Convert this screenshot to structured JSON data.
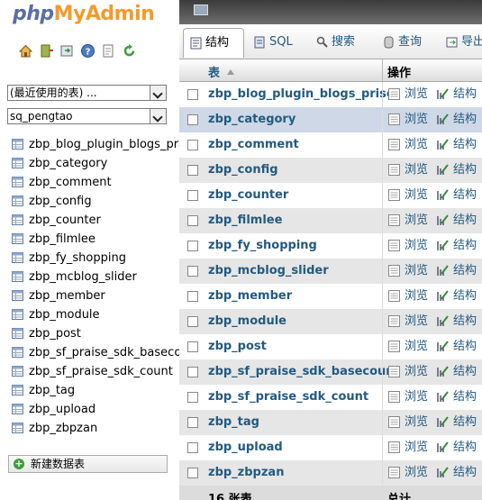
{
  "app": {
    "logo_php": "php",
    "logo_myadmin": "MyAdmin"
  },
  "nav_icons": [
    "home-icon",
    "exit-icon",
    "query-window-icon",
    "help-icon",
    "docs-icon",
    "reload-icon"
  ],
  "recent_select": {
    "value": "(最近使用的表) ..."
  },
  "db_select": {
    "value": "sq_pengtao"
  },
  "nav_tables": [
    "zbp_blog_plugin_blogs_praise",
    "zbp_category",
    "zbp_comment",
    "zbp_config",
    "zbp_counter",
    "zbp_filmlee",
    "zbp_fy_shopping",
    "zbp_mcblog_slider",
    "zbp_member",
    "zbp_module",
    "zbp_post",
    "zbp_sf_praise_sdk_basecount",
    "zbp_sf_praise_sdk_count",
    "zbp_tag",
    "zbp_upload",
    "zbp_zbpzan"
  ],
  "new_table": "新建数据表",
  "tabs": [
    {
      "label": "结构",
      "icon": "structure-icon",
      "active": true
    },
    {
      "label": "SQL",
      "icon": "sql-icon",
      "active": false
    },
    {
      "label": "搜索",
      "icon": "search-icon",
      "active": false
    },
    {
      "label": "查询",
      "icon": "query-icon",
      "active": false
    },
    {
      "label": "导出",
      "icon": "export-icon",
      "active": false
    }
  ],
  "table_header": {
    "table": "表",
    "actions": "操作"
  },
  "rows": [
    {
      "name": "zbp_blog_plugin_blogs_prise",
      "browse": "浏览",
      "structure": "结构"
    },
    {
      "name": "zbp_category",
      "browse": "浏览",
      "structure": "结构",
      "highlight": true
    },
    {
      "name": "zbp_comment",
      "browse": "浏览",
      "structure": "结构"
    },
    {
      "name": "zbp_config",
      "browse": "浏览",
      "structure": "结构"
    },
    {
      "name": "zbp_counter",
      "browse": "浏览",
      "structure": "结构"
    },
    {
      "name": "zbp_filmlee",
      "browse": "浏览",
      "structure": "结构"
    },
    {
      "name": "zbp_fy_shopping",
      "browse": "浏览",
      "structure": "结构"
    },
    {
      "name": "zbp_mcblog_slider",
      "browse": "浏览",
      "structure": "结构"
    },
    {
      "name": "zbp_member",
      "browse": "浏览",
      "structure": "结构"
    },
    {
      "name": "zbp_module",
      "browse": "浏览",
      "structure": "结构"
    },
    {
      "name": "zbp_post",
      "browse": "浏览",
      "structure": "结构"
    },
    {
      "name": "zbp_sf_praise_sdk_basecount",
      "browse": "浏览",
      "structure": "结构"
    },
    {
      "name": "zbp_sf_praise_sdk_count",
      "browse": "浏览",
      "structure": "结构"
    },
    {
      "name": "zbp_tag",
      "browse": "浏览",
      "structure": "结构"
    },
    {
      "name": "zbp_upload",
      "browse": "浏览",
      "structure": "结构"
    },
    {
      "name": "zbp_zbpzan",
      "browse": "浏览",
      "structure": "结构"
    }
  ],
  "footer": {
    "count": "16 张表",
    "total": "总计"
  }
}
